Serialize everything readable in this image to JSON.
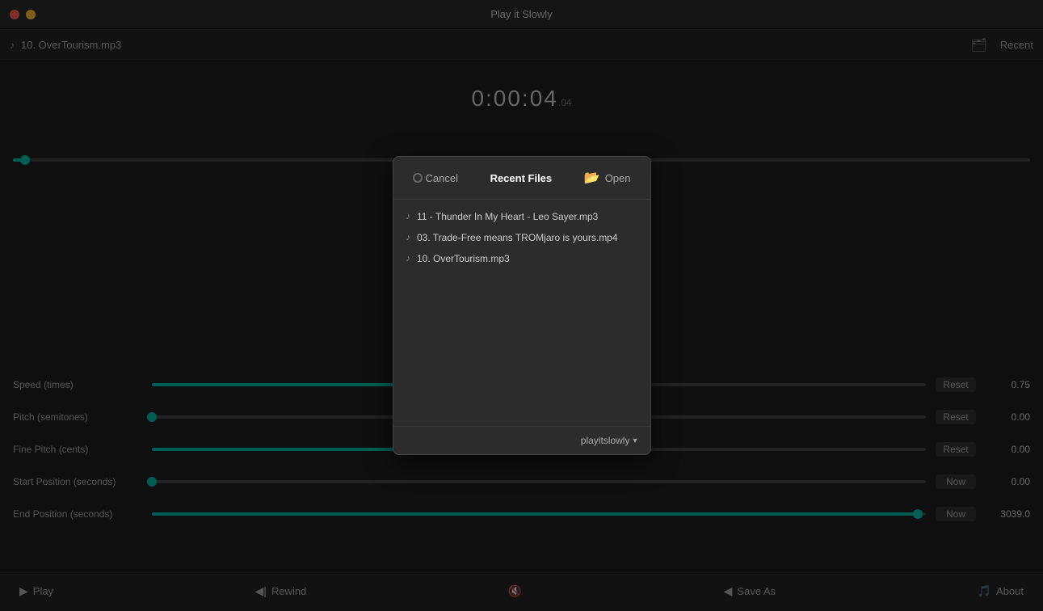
{
  "app": {
    "title": "Play it Slowly"
  },
  "titlebar": {
    "close_label": "",
    "minimize_label": ""
  },
  "filebar": {
    "file_icon": "♪",
    "file_name": "10. OverTourism.mp3",
    "folder_icon": "🗂",
    "recent_label": "Recent"
  },
  "player": {
    "time_display": "0:00:04",
    "time_sub": ".04",
    "seek_percent": 1.2
  },
  "sliders": [
    {
      "label": "Speed (times)",
      "percent": 47,
      "reset_label": "Reset",
      "value": "0.75"
    },
    {
      "label": "Pitch (semitones)",
      "percent": 0,
      "reset_label": "Reset",
      "value": "0.00"
    },
    {
      "label": "Fine Pitch (cents)",
      "percent": 50,
      "reset_label": "Reset",
      "value": "0.00"
    },
    {
      "label": "Start Position (seconds)",
      "percent": 0,
      "reset_label": "Now",
      "value": "0.00"
    },
    {
      "label": "End Position (seconds)",
      "percent": 99,
      "reset_label": "Now",
      "value": "3039.0"
    }
  ],
  "toolbar": {
    "play_label": "Play",
    "play_icon": "▶",
    "rewind_label": "Rewind",
    "rewind_icon": "◀|",
    "mute_icon": "🔇",
    "saveas_label": "Save As",
    "saveas_icon": "◀",
    "about_label": "About",
    "about_icon": "🎵"
  },
  "modal": {
    "cancel_label": "Cancel",
    "title": "Recent Files",
    "open_label": "Open",
    "open_icon": "📂",
    "files": [
      {
        "icon": "♪",
        "name": "11 - Thunder In My Heart - Leo Sayer.mp3"
      },
      {
        "icon": "♪",
        "name": "03. Trade-Free means TROMjaro is yours.mp4"
      },
      {
        "icon": "♪",
        "name": "10. OverTourism.mp3"
      }
    ],
    "profile_label": "playitslowly",
    "dropdown_icon": "▾"
  }
}
